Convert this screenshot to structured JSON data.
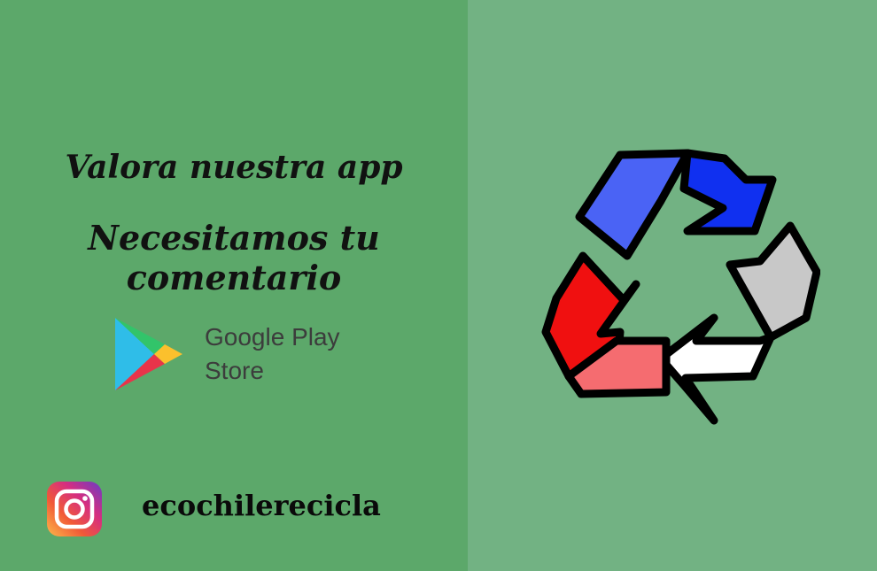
{
  "headline": {
    "line1": "Valora nuestra app",
    "line2": "Necesitamos tu comentario"
  },
  "store": {
    "line1": "Google Play",
    "line2": "Store",
    "icon": "google-play-icon"
  },
  "social": {
    "icon": "instagram-icon",
    "handle": "ecochilerecicla"
  },
  "illustration": {
    "icon": "recycle-icon",
    "colors": {
      "blue_dark": "#1030f0",
      "blue_light": "#4a63f5",
      "gray": "#c8c8c8",
      "white": "#ffffff",
      "red": "#f01010",
      "red_light": "#f56c70"
    }
  },
  "colors": {
    "left_bg": "#5ca86a",
    "right_bg": "#72b283"
  }
}
